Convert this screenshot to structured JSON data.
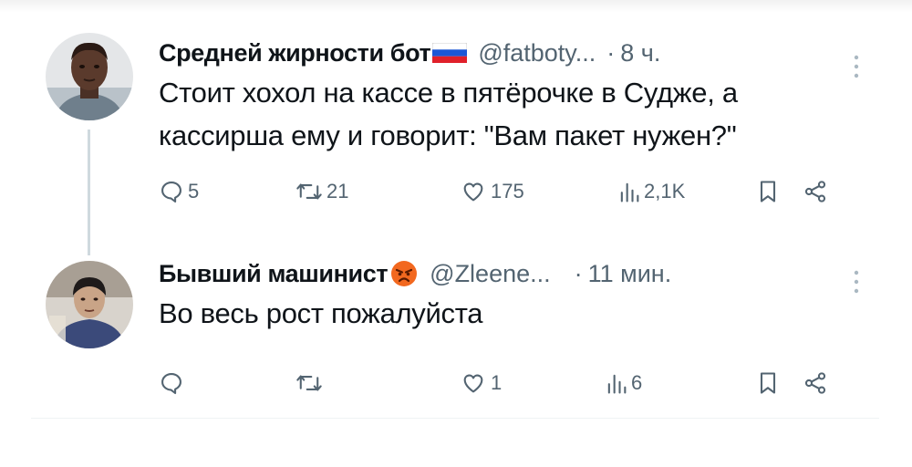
{
  "tweets": [
    {
      "author_name": "Средней жирности бот",
      "author_badge": "russia-flag",
      "handle": "@fatboty...",
      "dot": "·",
      "time": "8 ч.",
      "text_lines": [
        "Стоит хохол на кассе в пятёрочке в Судже, а",
        "кассирша ему и говорит: \"Вам пакет нужен?\""
      ],
      "stats": {
        "replies": "5",
        "reposts": "21",
        "likes": "175",
        "views": "2,1K"
      }
    },
    {
      "author_name": "Бывший машинист",
      "author_badge": "angry-face-emoji",
      "handle": "@Zleene...",
      "dot": "·",
      "time": "11 мин.",
      "text_lines": [
        "Во весь рост пожалуйста"
      ],
      "stats": {
        "replies": "",
        "reposts": "",
        "likes": "1",
        "views": "6"
      }
    }
  ],
  "colors": {
    "text": "#0f1419",
    "secondary": "#536471",
    "thread_line": "#cfd9de"
  }
}
